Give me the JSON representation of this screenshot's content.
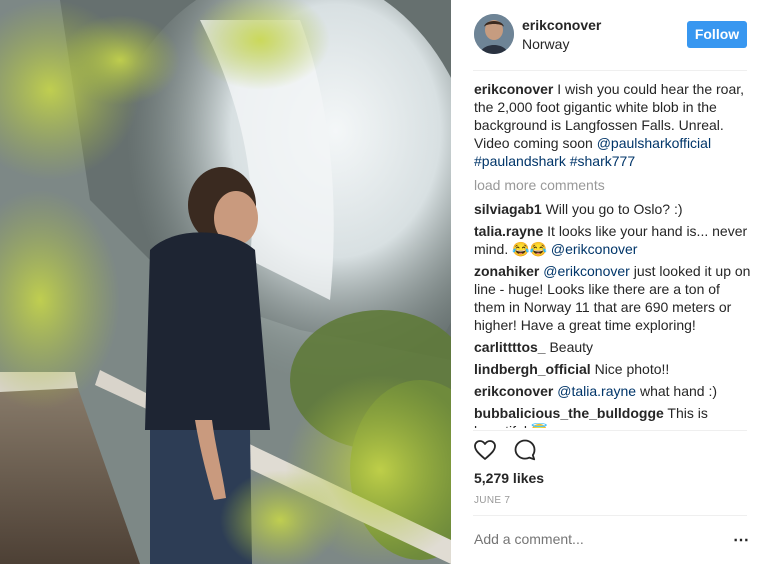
{
  "post": {
    "username": "erikconover",
    "location": "Norway",
    "follow_label": "Follow",
    "caption_user": "erikconover",
    "caption_text": " I wish you could hear the roar, the 2,000 foot gigantic white blob in the background is Langfossen Falls. Unreal. Video coming soon ",
    "caption_mention": "@paulsharkofficial",
    "caption_hashtags": "#paulandshark #shark777",
    "load_more": "load more comments",
    "likes": "5,279 likes",
    "date": "JUNE 7",
    "add_comment_placeholder": "Add a comment...",
    "more_icon": "⋯"
  },
  "comments": [
    {
      "user": "silviagab1",
      "pre": " Will you go to Oslo? :)",
      "mention": "",
      "post": ""
    },
    {
      "user": "talia.rayne",
      "pre": " It looks like your hand is... never mind. 😂😂 ",
      "mention": "@erikconover",
      "post": ""
    },
    {
      "user": "zonahiker",
      "pre": " ",
      "mention": "@erikconover",
      "post": " just looked it up on line - huge! Looks like there are a ton of them in Norway 11 that are 690 meters or higher! Have a great time exploring!"
    },
    {
      "user": "carlittttos_",
      "pre": " Beauty",
      "mention": "",
      "post": ""
    },
    {
      "user": "lindbergh_official",
      "pre": " Nice photo!!",
      "mention": "",
      "post": ""
    },
    {
      "user": "erikconover",
      "pre": " ",
      "mention": "@talia.rayne",
      "post": " what hand :)"
    },
    {
      "user": "bubbalicious_the_bulldogge",
      "pre": " This is beautiful 😇",
      "mention": "",
      "post": ""
    }
  ],
  "icons": {
    "like": "heart-icon",
    "comment": "speech-bubble-icon"
  },
  "colors": {
    "follow_bg": "#3897f0",
    "mention": "#003569",
    "muted": "#999999"
  }
}
